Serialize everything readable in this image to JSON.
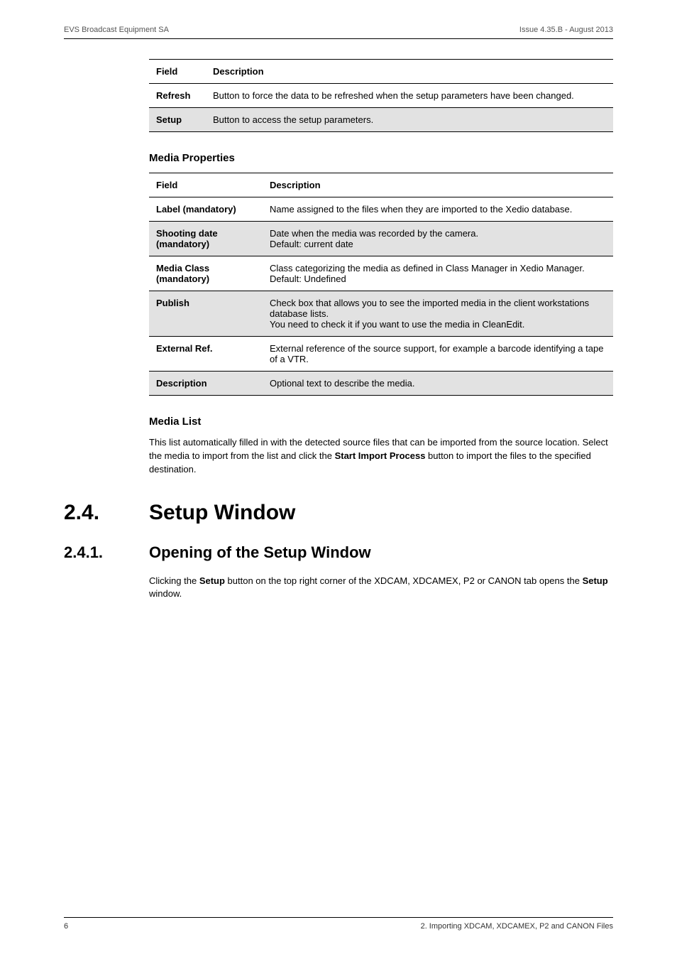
{
  "header": {
    "left": "EVS Broadcast Equipment SA",
    "right": "Issue 4.35.B - August 2013"
  },
  "table1": {
    "head": {
      "c1": "Field",
      "c2": "Description"
    },
    "rows": [
      {
        "c1": "Refresh",
        "c2": "Button to force the data to be refreshed when the setup parameters have been changed."
      },
      {
        "c1": "Setup",
        "c2": "Button to access the setup parameters."
      }
    ]
  },
  "media_properties": {
    "heading": "Media Properties",
    "head": {
      "c1": "Field",
      "c2": "Description"
    },
    "rows": [
      {
        "c1": "Label (mandatory)",
        "c2": "Name assigned to the files when they are imported to the Xedio database."
      },
      {
        "c1": "Shooting date (mandatory)",
        "c2": "Date when the media was recorded by the camera.\nDefault: current date"
      },
      {
        "c1": "Media Class (mandatory)",
        "c2": "Class categorizing the media as defined in Class Manager in Xedio Manager.\nDefault: Undefined"
      },
      {
        "c1": "Publish",
        "c2": "Check box that allows you to see the imported media in the client workstations database lists.\nYou need to check it if you want to use the media in CleanEdit."
      },
      {
        "c1": "External Ref.",
        "c2": "External reference of the source support, for example a barcode identifying a tape of a VTR."
      },
      {
        "c1": "Description",
        "c2": "Optional text to describe the media."
      }
    ]
  },
  "media_list": {
    "heading": "Media List",
    "body_pre": "This list automatically filled in with the detected source files that can be imported from the source location. Select the media to import from the list and click the ",
    "body_bold1": "Start Import Process",
    "body_post": " button to import the files to the specified destination."
  },
  "sec24": {
    "num": "2.4.",
    "title": "Setup Window"
  },
  "sec241": {
    "num": "2.4.1.",
    "title": "Opening of the Setup Window",
    "body_pre": "Clicking the ",
    "body_b1": "Setup",
    "body_mid": " button on the top right corner of the XDCAM, XDCAMEX, P2 or CANON tab opens the ",
    "body_b2": "Setup",
    "body_post": " window."
  },
  "footer": {
    "left": "6",
    "right": "2. Importing XDCAM, XDCAMEX, P2 and CANON Files"
  }
}
